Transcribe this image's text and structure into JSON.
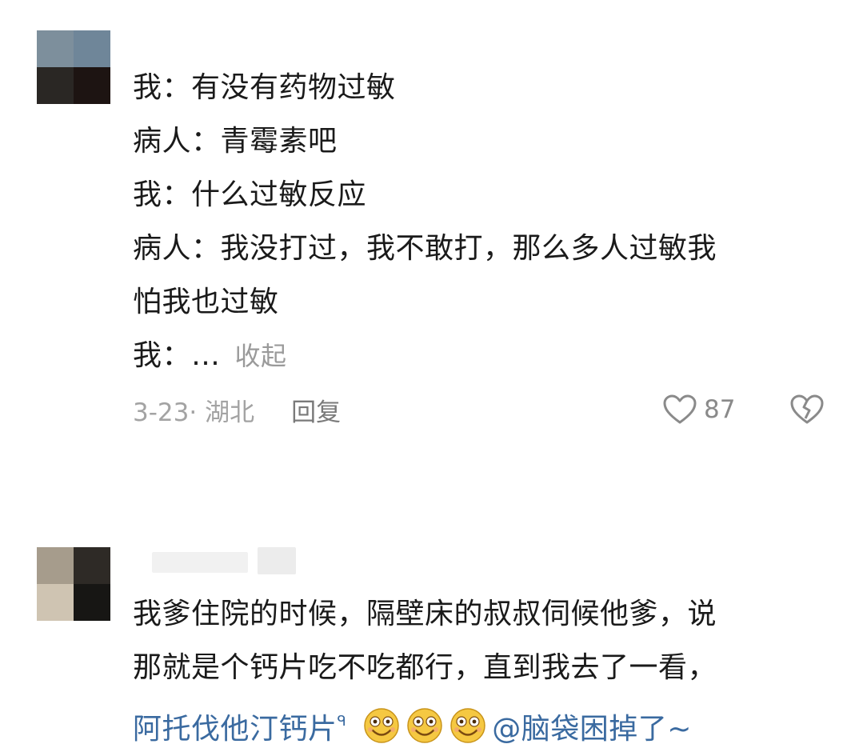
{
  "comment1": {
    "lines": [
      "我：有没有药物过敏",
      "病人：青霉素吧",
      "我：什么过敏反应",
      "病人：我没打过，我不敢打，那么多人过敏我",
      "怕我也过敏"
    ],
    "last_line_prefix": "我：…",
    "collapse_label": "收起",
    "date_location": "3-23· 湖北",
    "reply_label": "回复",
    "like_count": "87",
    "avatar_colors": [
      "#7d8f9c",
      "#6f8699",
      "#2a2724",
      "#1d1412"
    ]
  },
  "comment2": {
    "lines": [
      "我爹住院的时候，隔壁床的叔叔伺候他爹，说",
      "那就是个钙片吃不吃都行，直到我去了一看，"
    ],
    "drug_link": "阿托伐他汀钙片",
    "mention": "@脑袋困掉了~",
    "avatar_colors": [
      "#a69c8c",
      "#2e2a26",
      "#cfc4b2",
      "#171614"
    ],
    "emojis": [
      "smiling-face-icon",
      "smiling-face-icon",
      "smiling-face-icon"
    ]
  },
  "colors": {
    "text": "#1a1a1a",
    "muted": "#a3a3a3",
    "link": "#3a6aa0",
    "emoji_face": "#f5c842"
  }
}
